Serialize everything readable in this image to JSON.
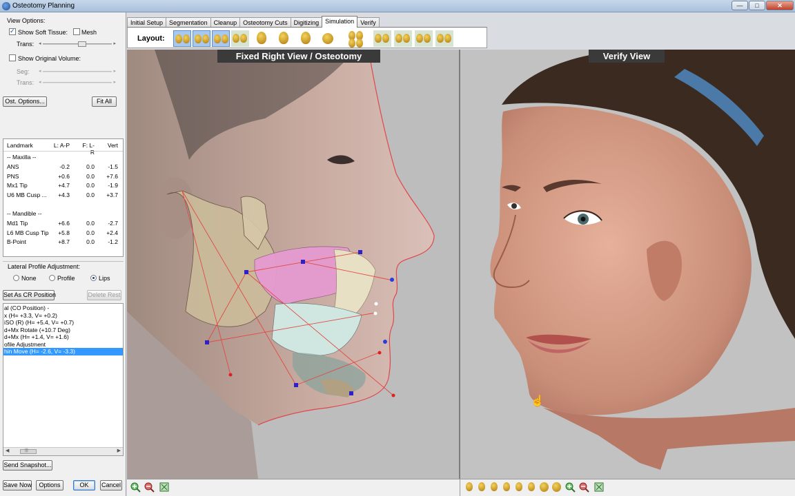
{
  "window": {
    "title": "Osteotomy Planning",
    "buttons": {
      "minimize": "—",
      "maximize": "□",
      "close": "✕"
    }
  },
  "view_options": {
    "heading": "View Options:",
    "show_soft_tissue": {
      "label": "Show Soft Tissue:",
      "checked": true
    },
    "mesh": {
      "label": "Mesh",
      "checked": false
    },
    "trans1_label": "Trans:",
    "trans1_level_pct": 50,
    "show_original_volume": {
      "label": "Show Original Volume:",
      "checked": false
    },
    "seg_label": "Seg:",
    "trans2_label": "Trans:"
  },
  "buttons": {
    "ost_options": "Ost. Options...",
    "fit_all": "Fit All",
    "set_cr": "Set As CR Position",
    "delete_rest": "Delete Rest",
    "send_snapshot": "Send Snapshot...",
    "save_now": "Save Now",
    "options": "Options",
    "ok": "OK",
    "cancel": "Cancel"
  },
  "landmarks": {
    "headers": [
      "Landmark",
      "L: A-P",
      "F: L-R",
      "Vert"
    ],
    "rows": [
      {
        "name": "-- Maxilla --",
        "ap": "",
        "lr": "",
        "vert": ""
      },
      {
        "name": "ANS",
        "ap": "-0.2",
        "lr": "0.0",
        "vert": "-1.5"
      },
      {
        "name": "PNS",
        "ap": "+0.6",
        "lr": "0.0",
        "vert": "+7.6"
      },
      {
        "name": "Mx1 Tip",
        "ap": "+4.7",
        "lr": "0.0",
        "vert": "-1.9"
      },
      {
        "name": "U6 MB Cusp ...",
        "ap": "+4.3",
        "lr": "0.0",
        "vert": "+3.7"
      },
      {
        "name": "",
        "ap": "",
        "lr": "",
        "vert": ""
      },
      {
        "name": "-- Mandible --",
        "ap": "",
        "lr": "",
        "vert": ""
      },
      {
        "name": "Md1 Tip",
        "ap": "+6.6",
        "lr": "0.0",
        "vert": "-2.7"
      },
      {
        "name": "L6 MB Cusp Tip",
        "ap": "+5.8",
        "lr": "0.0",
        "vert": "+2.4"
      },
      {
        "name": "B-Point",
        "ap": "+8.7",
        "lr": "0.0",
        "vert": "-1.2"
      }
    ]
  },
  "lateral_profile": {
    "heading": "Lateral Profile Adjustment:",
    "options": [
      "None",
      "Profile",
      "Lips"
    ],
    "selected": "Lips"
  },
  "history": {
    "items": [
      "al (CO Position) -",
      "x (H= +3.3, V= +0.2)",
      "iSO (R) (H= +5.4, V= +0.7)",
      "d+Mx Rotate (+10.7 Deg)",
      "d+Mx (H= +1.4, V= +1.6)",
      "ofile Adjustment",
      "hin Move (H= -2.6, V= -3.3)"
    ],
    "selected_index": 6,
    "scroll_left": "◀",
    "scroll_right": "▶",
    "scroll_grip": "|||"
  },
  "tabs": {
    "items": [
      "Initial Setup",
      "Segmentation",
      "Cleanup",
      "Osteotomy Cuts",
      "Digitizing",
      "Simulation",
      "Verify"
    ],
    "active": "Simulation"
  },
  "layout_label": "Layout:",
  "views": {
    "left_title": "Fixed Right View / Osteotomy",
    "right_title": "Verify View"
  },
  "icons": {
    "layout_buttons": "head-layout-icon",
    "bottom_left": [
      "zoom-in-icon",
      "zoom-out-icon",
      "fit-view-icon"
    ],
    "bottom_right": [
      "head-view-icon",
      "zoom-in-icon",
      "zoom-out-icon",
      "fit-view-icon"
    ]
  }
}
